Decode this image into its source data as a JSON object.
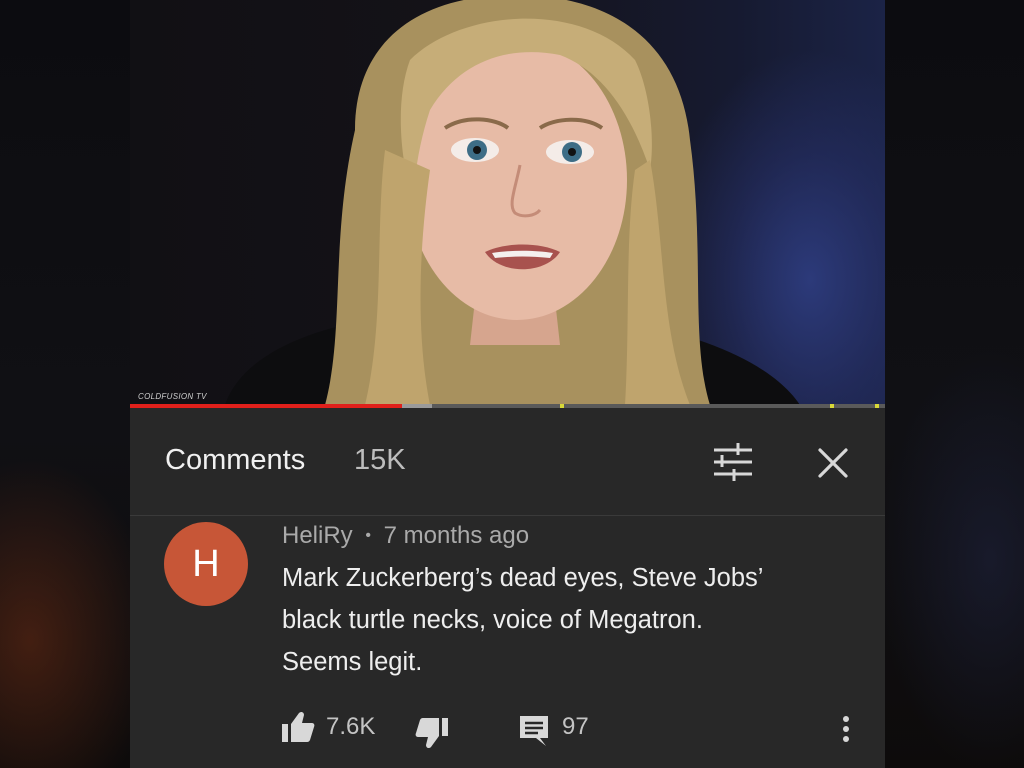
{
  "video": {
    "watermark": "COLDFUSION TV",
    "progress_played": 0.36,
    "progress_buffered": 0.4
  },
  "comments_header": {
    "title": "Comments",
    "count": "15K",
    "filter_icon": "sort-sliders-icon",
    "close_icon": "close-icon"
  },
  "comment": {
    "avatar_letter": "H",
    "avatar_color": "#c75637",
    "author": "HeliRy",
    "separator": "•",
    "time": "7 months ago",
    "lines": [
      "Mark Zuckerberg’s dead eyes, Steve Jobs’",
      "black turtle necks, voice of Megatron.",
      "Seems legit."
    ],
    "likes": "7.6K",
    "replies": "97",
    "like_icon": "thumbs-up-icon",
    "dislike_icon": "thumbs-down-icon",
    "reply_icon": "reply-icon",
    "more_icon": "more-vertical-icon"
  },
  "colors": {
    "panel_bg": "#282828",
    "progress_red": "#e0201b"
  }
}
